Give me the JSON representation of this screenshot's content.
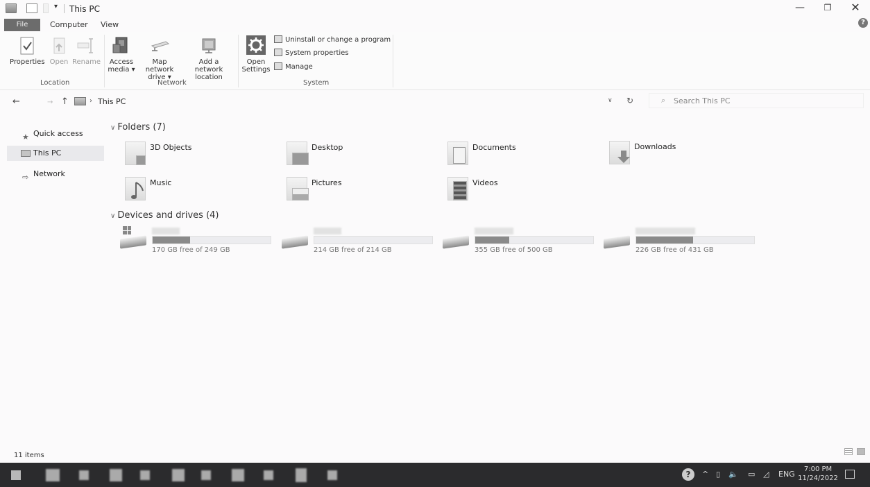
{
  "window": {
    "title": "This PC",
    "minimize": "—",
    "maximize": "❐",
    "close": "✕",
    "qa_arrow": "▾"
  },
  "ribbon": {
    "tabs": {
      "file": "File",
      "computer": "Computer",
      "view": "View"
    },
    "help": "?",
    "location": {
      "label": "Location",
      "properties": "Properties",
      "open": "Open",
      "rename": "Rename"
    },
    "network": {
      "label": "Network",
      "access_media": [
        "Access",
        "media ▾"
      ],
      "map_network_drive": [
        "Map network",
        "drive ▾"
      ],
      "add_network_location": [
        "Add a network",
        "location"
      ]
    },
    "system": {
      "label": "System",
      "open_settings": [
        "Open",
        "Settings"
      ],
      "uninstall": "Uninstall or change a program",
      "system_properties": "System properties",
      "manage": "Manage"
    }
  },
  "address": {
    "back": "←",
    "forward": "→",
    "up": "↑",
    "separator": "›",
    "path": "This PC",
    "dropdown": "∨",
    "refresh": "↻",
    "search_placeholder": "Search This PC"
  },
  "nav_pane": [
    {
      "label": "Quick access",
      "icon": "star-icon",
      "glyph": "★",
      "selected": false
    },
    {
      "label": "This PC",
      "icon": "pc-icon",
      "glyph": "",
      "selected": true
    },
    {
      "label": "Network",
      "icon": "network-icon",
      "glyph": "⇨",
      "selected": false
    }
  ],
  "folders": {
    "header": "Folders (7)",
    "items": [
      {
        "name": "3D Objects"
      },
      {
        "name": "Desktop"
      },
      {
        "name": "Documents"
      },
      {
        "name": "Downloads"
      },
      {
        "name": "Music"
      },
      {
        "name": "Pictures"
      },
      {
        "name": "Videos"
      }
    ]
  },
  "drives": {
    "header": "Devices and drives (4)",
    "items": [
      {
        "free_text": "170 GB free of 249 GB",
        "used_fraction": 0.32,
        "system": true
      },
      {
        "free_text": "214 GB free of 214 GB",
        "used_fraction": 0.0,
        "system": false
      },
      {
        "free_text": "355 GB free of 500 GB",
        "used_fraction": 0.29,
        "system": false
      },
      {
        "free_text": "226 GB free of 431 GB",
        "used_fraction": 0.48,
        "system": false
      }
    ]
  },
  "status": {
    "item_count": "11 items"
  },
  "taskbar": {
    "language": "ENG",
    "time": "7:00 PM",
    "date": "11/24/2022",
    "tray_help": "?",
    "tray_chevron": "^",
    "tray_volume": "🔈"
  },
  "colors": {
    "accent_file_tab": "#6c6c6c",
    "taskbar": "#2b2b2d",
    "drive_fill": "#8a8a8a"
  }
}
